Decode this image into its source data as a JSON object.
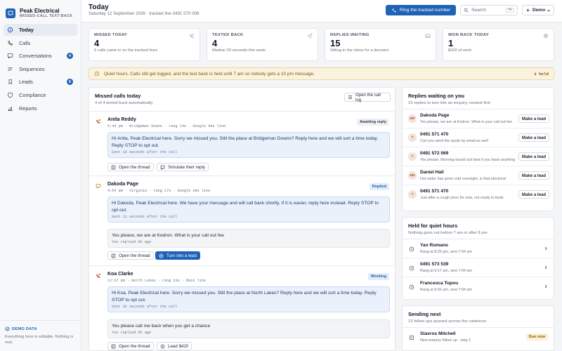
{
  "brand": {
    "name": "Peak Electrical",
    "sub": "MISSED-CALL TEXT-BACK"
  },
  "nav": [
    {
      "label": "Today",
      "icon": "home-icon",
      "active": true,
      "badge": null
    },
    {
      "label": "Calls",
      "icon": "phone-icon",
      "active": false,
      "badge": null
    },
    {
      "label": "Conversations",
      "icon": "chat-icon",
      "active": false,
      "badge": "4"
    },
    {
      "label": "Sequences",
      "icon": "sequence-icon",
      "active": false,
      "badge": null
    },
    {
      "label": "Leads",
      "icon": "lead-icon",
      "active": false,
      "badge": "8"
    },
    {
      "label": "Compliance",
      "icon": "shield-icon",
      "active": false,
      "badge": null
    },
    {
      "label": "Reports",
      "icon": "chart-icon",
      "active": false,
      "badge": null
    }
  ],
  "demo": {
    "tag": "DEMO DATA",
    "text": "Everything here is editable. Nothing is real."
  },
  "header": {
    "title": "Today",
    "subtitle": "Saturday 12 September 2026 · tracked line 0491 570 006",
    "ring_label": "Ring the tracked number",
    "search_placeholder": "Search",
    "search_shortcut": "⌘K",
    "demo_label": "Demo"
  },
  "stats": [
    {
      "label": "MISSED TODAY",
      "value": "4",
      "note": "6 calls came in on the tracked lines",
      "icon": "phone-missed-icon"
    },
    {
      "label": "TEXTED BACK",
      "value": "4",
      "note": "Median 20 seconds this week",
      "icon": "send-icon"
    },
    {
      "label": "REPLIES WAITING",
      "value": "15",
      "note": "Sitting in the inbox for a decision",
      "icon": "inbox-icon"
    },
    {
      "label": "WON BACK TODAY",
      "value": "1",
      "note": "$420 of work",
      "icon": "coin-icon"
    }
  ],
  "banner": {
    "text": "Quiet hours. Calls still get logged, and the text back is held until 7 am so nobody gets a 10 pm message.",
    "tag": "3 held",
    "accent": "#fbf3df"
  },
  "missed": {
    "title": "Missed calls today",
    "subtitle": "4 of 4 texted back automatically",
    "calllog_label": "Open the call log",
    "calls": [
      {
        "name": "Anita Reddy",
        "meta": "5:44 pm · Bridgeman Downs · rang 14s · Google Ads line",
        "status": "Awaiting reply",
        "message": "Hi Anita, Peak Electrical here. Sorry we missed you. Still the place at Bridgeman Downs? Reply here and we will sort a time today. Reply STOP to opt out.",
        "sent": "Sent 19 seconds after the call",
        "reply": null,
        "actions": [
          "Open the thread",
          "Simulate their reply"
        ]
      },
      {
        "name": "Dakoda Page",
        "meta": "4:54 pm · Virginia · rang 17s · Google Ads line",
        "status": "Replied",
        "message": "Hi Dakoda, Peak Electrical here. We have your message and will call back shortly. If it is easier, reply here instead. Reply STOP to opt out.",
        "sent": "Sent 11 seconds after the call",
        "reply": {
          "text": "Yes please, we are at Kedron. What is your call out fee",
          "meta": "Yes replied 6h ago"
        },
        "actions": [
          "Open the thread",
          "Turn into a lead"
        ]
      },
      {
        "name": "Koa Clarke",
        "meta": "12:37 pm · North Lakes · rang 23s · Main line",
        "status": "Working",
        "message": "Hi Koa, Peak Electrical here. Sorry we missed you. Still the place at North Lakes? Reply here and we will sort a time today. Reply STOP to opt out.",
        "sent": "Sent 36 seconds after the call",
        "reply": {
          "text": "Yes please call me back when you get a chance",
          "meta": "Yes replied 8h ago"
        },
        "actions": [
          "Open the thread",
          "Lead $420"
        ]
      }
    ]
  },
  "replies": {
    "title": "Replies waiting on you",
    "subtitle": "15 replies to turn into an enquiry, newest first",
    "button_label": "Make a lead",
    "items": [
      {
        "initials": "DP",
        "name": "Dakoda Page",
        "text": "Yes please, we are at Kedron. What is your call out fee"
      },
      {
        "initials": "?",
        "name": "0491 571 470",
        "text": "Can you send the quote by email as well"
      },
      {
        "initials": "?",
        "name": "0491 572 069",
        "text": "Yes please. Morning would suit best if you have anything"
      },
      {
        "initials": "DH",
        "name": "Daniel Hall",
        "text": "Hot water has gone cold overnight, is that electrical"
      },
      {
        "initials": "?",
        "name": "0491 571 470",
        "text": "Just after a rough price for now, not ready to book"
      }
    ]
  },
  "quiet": {
    "title": "Held for quiet hours",
    "subtitle": "Nothing goes out before 7 am or after 8 pm",
    "items": [
      {
        "name": "Yan Romano",
        "text": "Rang at 8:25 pm, sent 7:04 am"
      },
      {
        "name": "0491 573 539",
        "text": "Rang at 6:17 am, sent 7:04 am"
      },
      {
        "name": "Francesca Tupou",
        "text": "Rang at 6:02 am, sent 7:04 am"
      }
    ]
  },
  "next": {
    "title": "Sending next",
    "subtitle": "13 follow ups queued across the cadences",
    "items": [
      {
        "name": "Stavros Mitchell",
        "text": "New enquiry follow up · step 1",
        "due": "Due now"
      }
    ]
  },
  "colors": {
    "accent": "#1f63b7",
    "warning_bg": "#fbf3df"
  }
}
